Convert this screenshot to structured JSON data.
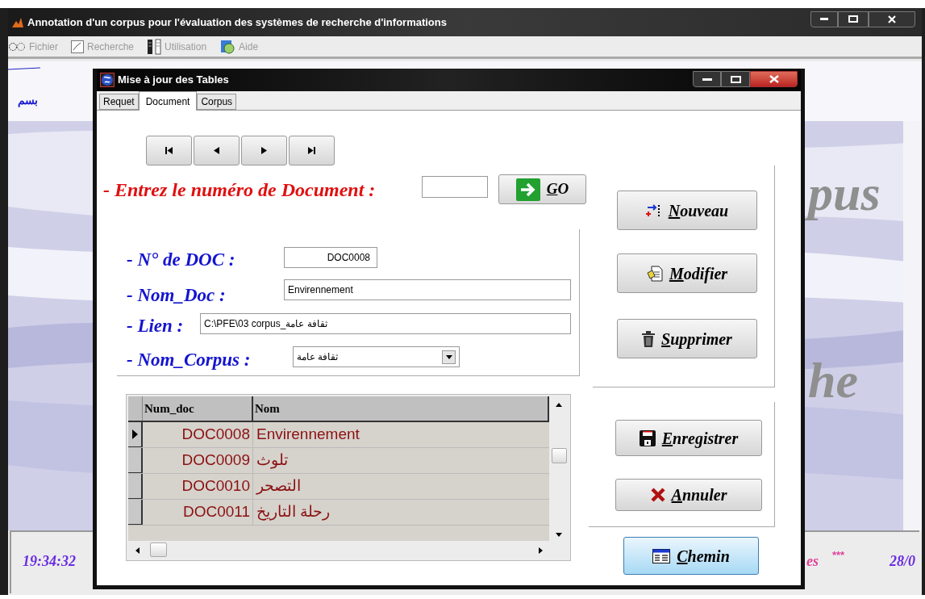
{
  "main_window": {
    "title": "Annotation d'un corpus pour l'évaluation des systèmes de recherche d'informations",
    "menu": [
      {
        "label": "Fichier",
        "disabled": true
      },
      {
        "label": "Recherche",
        "disabled": true
      },
      {
        "label": "Utilisation",
        "disabled": true
      },
      {
        "label": "Aide",
        "disabled": true
      }
    ],
    "header_text": "بسم",
    "banner_words": [
      "pus",
      "he"
    ],
    "status_bar": {
      "time": "19:34:32",
      "message": "es",
      "separator": "***",
      "date": "28/0"
    }
  },
  "dialog": {
    "title": "Mise à jour des Tables",
    "tabs": [
      {
        "label": "Requet",
        "selected": false
      },
      {
        "label": "Document",
        "selected": true
      },
      {
        "label": "Corpus",
        "selected": false
      }
    ],
    "nav_buttons": [
      {
        "kind": "first"
      },
      {
        "kind": "previous"
      },
      {
        "kind": "next"
      },
      {
        "kind": "last"
      }
    ],
    "prompt": "- Entrez le numéro de Document :",
    "go_button": "GO",
    "fields": [
      {
        "kind": "code",
        "label": "- N° de DOC :",
        "value": "DOC0008"
      },
      {
        "kind": "text",
        "label": "- Nom_Doc :",
        "value": "Envirennement"
      },
      {
        "kind": "text",
        "label": "- Lien :",
        "value": "C:\\PFE\\03 corpus_ثقافة عامة"
      },
      {
        "kind": "select",
        "label": "- Nom_Corpus :",
        "value": "ثقافة عامة"
      }
    ],
    "grid": {
      "columns": [
        "Num_doc",
        "Nom"
      ],
      "rows": [
        {
          "num_doc": "DOC0008",
          "nom": "Envirennement",
          "selected": true
        },
        {
          "num_doc": "DOC0009",
          "nom": "تلوث",
          "selected": false
        },
        {
          "num_doc": "DOC0010",
          "nom": "التصحر",
          "selected": false
        },
        {
          "num_doc": "DOC0011",
          "nom": "رحلة التاريخ",
          "selected": false
        }
      ]
    },
    "actions": [
      {
        "label": "Nouveau"
      },
      {
        "label": "Modifier"
      },
      {
        "label": "Supprimer"
      }
    ],
    "save_actions": [
      {
        "label": "Enregistrer"
      },
      {
        "label": "Annuler"
      }
    ],
    "path_button": {
      "label": "Chemin",
      "focused": true
    }
  }
}
